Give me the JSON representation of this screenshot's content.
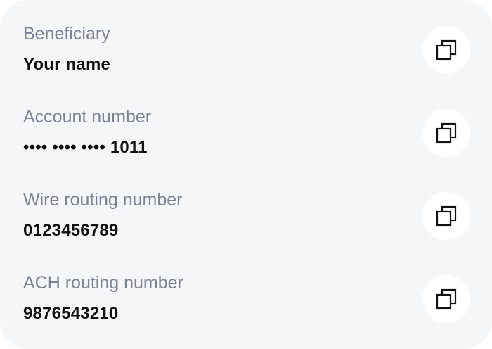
{
  "fields": [
    {
      "label": "Beneficiary",
      "value": "Your name",
      "action_icon": "copy-icon"
    },
    {
      "label": "Account number",
      "value": "•••• •••• •••• 1011",
      "action_icon": "copy-icon"
    },
    {
      "label": "Wire routing number",
      "value": "0123456789",
      "action_icon": "copy-icon"
    },
    {
      "label": "ACH routing number",
      "value": "9876543210",
      "action_icon": "copy-icon"
    }
  ],
  "colors": {
    "card_background": "#f5f6f8",
    "label_text": "#7a8293",
    "value_text": "#111111",
    "button_background": "#ffffff"
  }
}
